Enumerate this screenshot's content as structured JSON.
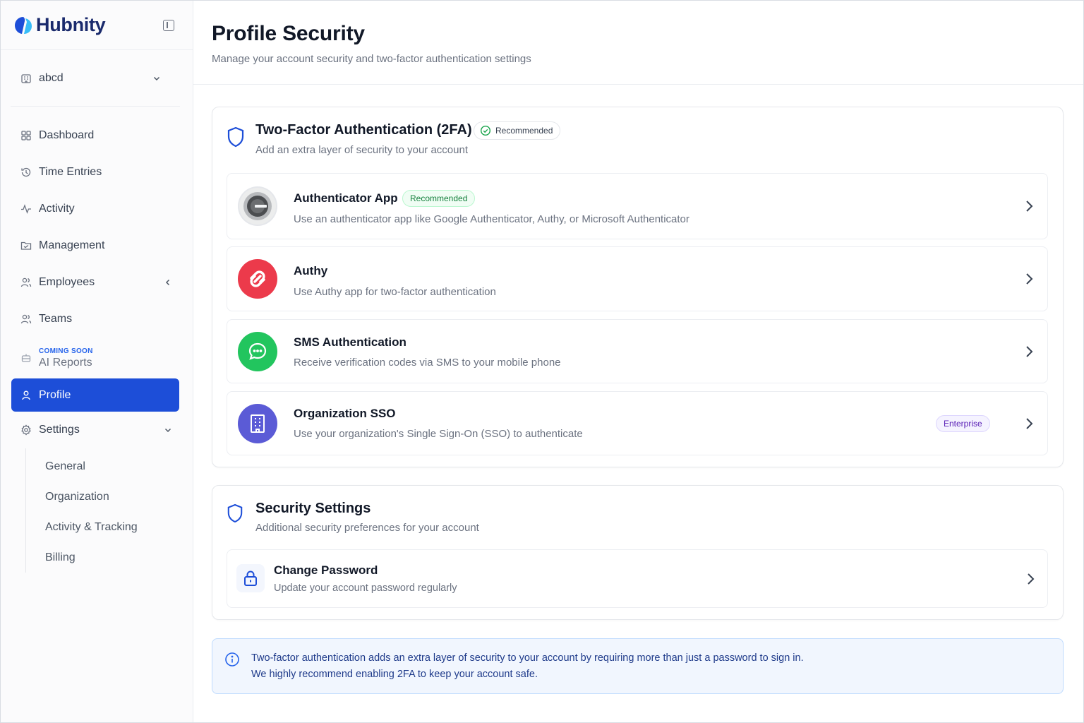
{
  "brand": {
    "name": "Hubnity"
  },
  "workspace": {
    "name": "abcd"
  },
  "sidebar": {
    "items": [
      {
        "label": "Dashboard"
      },
      {
        "label": "Time Entries"
      },
      {
        "label": "Activity"
      },
      {
        "label": "Management"
      },
      {
        "label": "Employees"
      },
      {
        "label": "Teams"
      },
      {
        "label": "AI Reports",
        "tag": "COMING SOON"
      },
      {
        "label": "Profile"
      },
      {
        "label": "Settings"
      }
    ],
    "settings_sub": [
      {
        "label": "General"
      },
      {
        "label": "Organization"
      },
      {
        "label": "Activity & Tracking"
      },
      {
        "label": "Billing"
      }
    ]
  },
  "header": {
    "title": "Profile Security",
    "subtitle": "Manage your account security and two-factor authentication settings"
  },
  "twofa": {
    "title": "Two-Factor Authentication (2FA)",
    "badge": "Recommended",
    "desc": "Add an extra layer of security to your account",
    "options": [
      {
        "title": "Authenticator App",
        "badge": "Recommended",
        "desc": "Use an authenticator app like Google Authenticator, Authy, or Microsoft Authenticator"
      },
      {
        "title": "Authy",
        "desc": "Use Authy app for two-factor authentication"
      },
      {
        "title": "SMS Authentication",
        "desc": "Receive verification codes via SMS to your mobile phone"
      },
      {
        "title": "Organization SSO",
        "badge": "Enterprise",
        "desc": "Use your organization's Single Sign-On (SSO) to authenticate"
      }
    ]
  },
  "security": {
    "title": "Security Settings",
    "desc": "Additional security preferences for your account",
    "change_password": {
      "title": "Change Password",
      "desc": "Update your account password regularly"
    }
  },
  "info": {
    "line1": "Two-factor authentication adds an extra layer of security to your account by requiring more than just a password to sign in.",
    "line2": "We highly recommend enabling 2FA to keep your account safe."
  },
  "colors": {
    "accent": "#1d4ed8",
    "authy": "#ec3a4b",
    "sms": "#22c55e",
    "sso": "#5b5bd6",
    "info_bg": "#f1f6fe"
  },
  "icons": {
    "logo": "hubnity-logo",
    "workspace": "building-icon",
    "nav": [
      "grid-icon",
      "history-icon",
      "pulse-icon",
      "folder-icon",
      "users-icon",
      "users-icon",
      "bot-icon",
      "user-icon",
      "gear-icon"
    ]
  }
}
